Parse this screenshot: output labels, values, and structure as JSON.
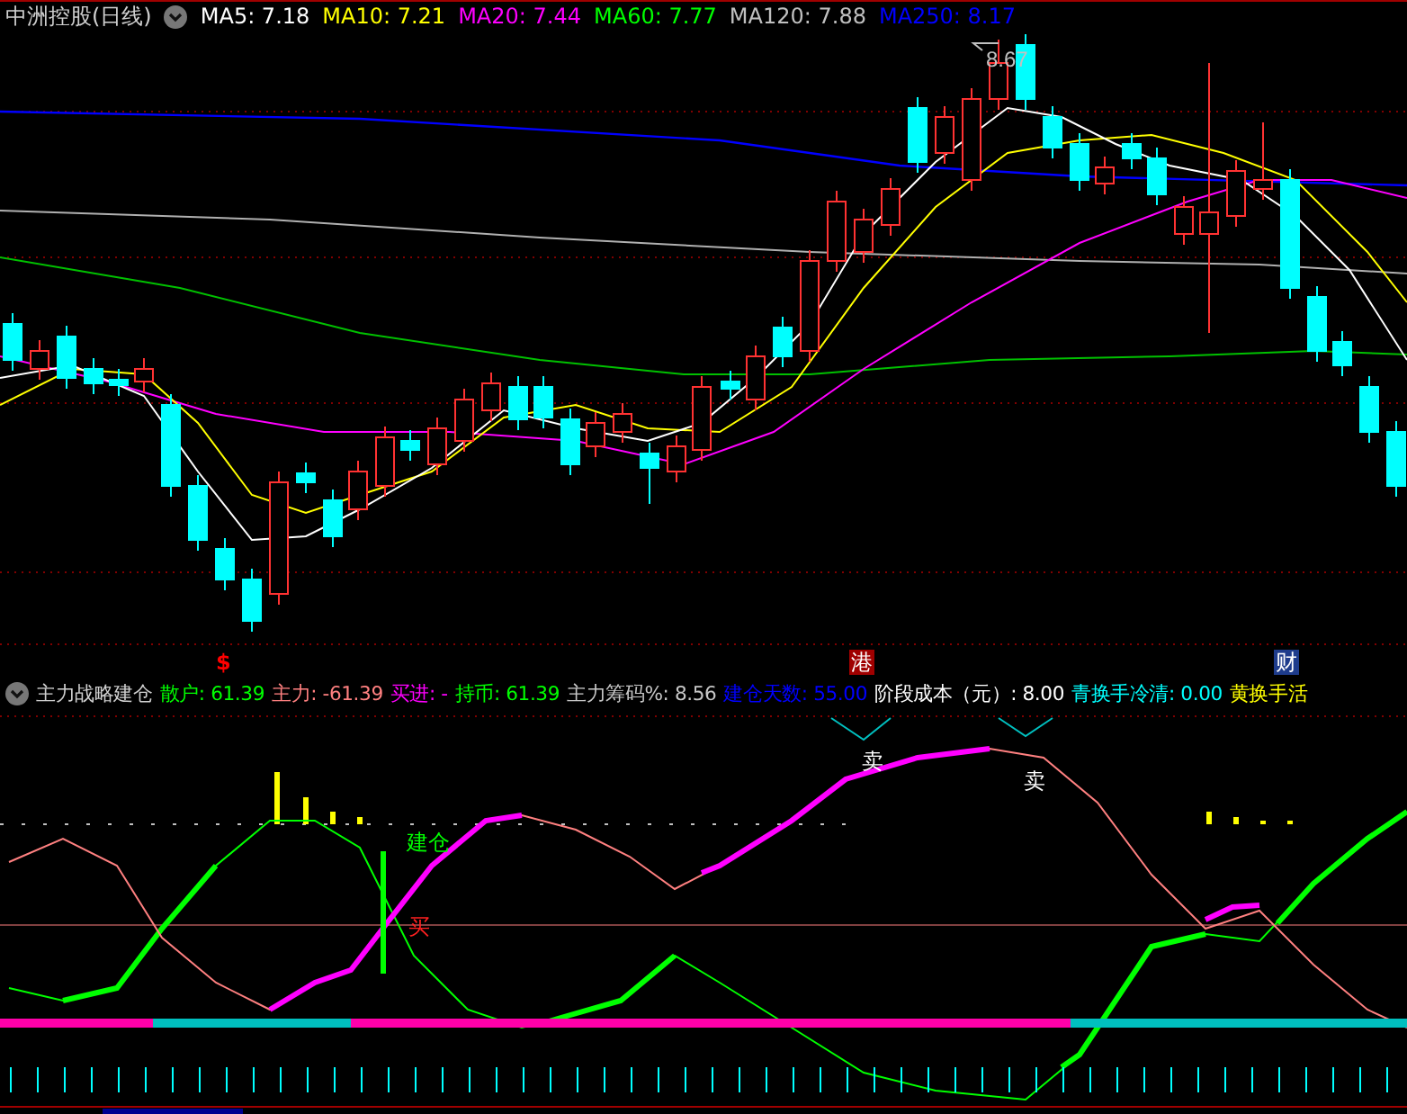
{
  "title": "中洲控股(日线)",
  "moving_averages": [
    {
      "text": "MA5: 7.18",
      "color": "#ffffff"
    },
    {
      "text": "MA10: 7.21",
      "color": "#ffff00"
    },
    {
      "text": "MA20: 7.44",
      "color": "#ff00ff"
    },
    {
      "text": "MA60: 7.77",
      "color": "#00ff00"
    },
    {
      "text": "MA120: 7.88",
      "color": "#c0c0c0"
    },
    {
      "text": "MA250: 8.17",
      "color": "#0000ff"
    }
  ],
  "high_label": "8.67",
  "markers": [
    {
      "text": "$",
      "kind": "plain",
      "color": "#ff0000"
    },
    {
      "text": "港",
      "kind": "badge",
      "color": "#a00000"
    },
    {
      "text": "财",
      "kind": "badge",
      "color": "#1e3c8c"
    }
  ],
  "indicator": {
    "name": "主力战略建仓",
    "legend": [
      {
        "text": "散户: 61.39",
        "color": "#00ff00"
      },
      {
        "text": "主力: -61.39",
        "color": "#ff8080"
      },
      {
        "text": "买进: -",
        "color": "#ff00ff"
      },
      {
        "text": "持币: 61.39",
        "color": "#00ff00"
      },
      {
        "text": "主力筹码%: 8.56",
        "color": "#c8c8c8"
      },
      {
        "text": "建仓天数: 55.00",
        "color": "#0000ff"
      },
      {
        "text": "阶段成本（元）: 8.00",
        "color": "#ffffff"
      },
      {
        "text": "青换手冷清: 0.00",
        "color": "#00ffff"
      },
      {
        "text": "黄换手活",
        "color": "#ffff00"
      }
    ],
    "labels": [
      {
        "text": "卖",
        "kind": "sell"
      },
      {
        "text": "卖",
        "kind": "sell"
      },
      {
        "text": "建仓",
        "kind": "build"
      },
      {
        "text": "买",
        "kind": "buy"
      }
    ]
  }
}
